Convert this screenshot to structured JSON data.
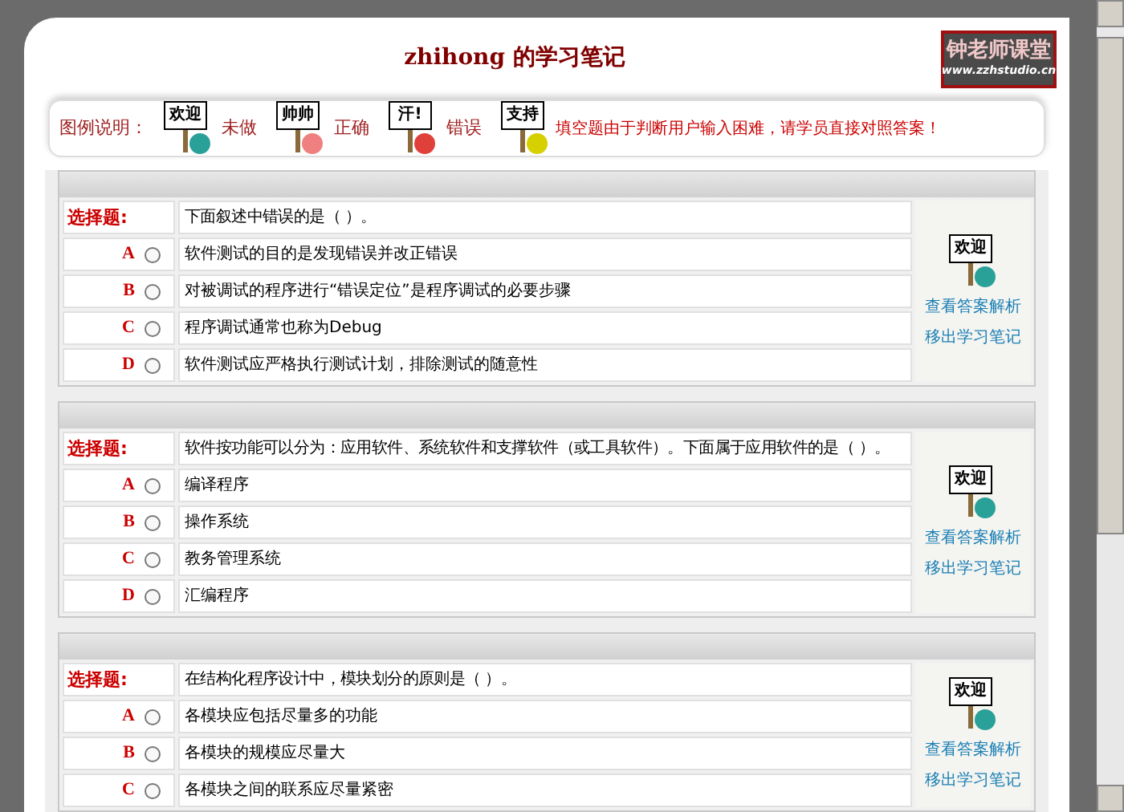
{
  "header": {
    "title": "zhihong 的学习笔记",
    "logo": {
      "name": "钟老师课堂",
      "url": "www.zzhstudio.cn"
    }
  },
  "legend": {
    "label": "图例说明：",
    "items": [
      {
        "sign": "欢迎",
        "label": "未做",
        "color": "#2aa198"
      },
      {
        "sign": "帅帅",
        "label": "正确",
        "color": "#f08080"
      },
      {
        "sign": "汗!",
        "label": "错误",
        "color": "#e0403a"
      },
      {
        "sign": "支持"
      }
    ],
    "note": "填空题由于判断用户输入困难，请学员直接对照答案！"
  },
  "questions": [
    {
      "type_label": "选择题:",
      "text": "下面叙述中错误的是（ ）。",
      "status_sign": "欢迎",
      "links": [
        "查看答案解析",
        "移出学习笔记"
      ],
      "options": [
        {
          "letter": "A",
          "text": "软件测试的目的是发现错误并改正错误",
          "selected": false
        },
        {
          "letter": "B",
          "text": "对被调试的程序进行“错误定位”是程序调试的必要步骤",
          "selected": false
        },
        {
          "letter": "C",
          "text": "程序调试通常也称为Debug",
          "selected": false
        },
        {
          "letter": "D",
          "text": "软件测试应严格执行测试计划，排除测试的随意性",
          "selected": false
        }
      ]
    },
    {
      "type_label": "选择题:",
      "text": "软件按功能可以分为：应用软件、系统软件和支撑软件（或工具软件）。下面属于应用软件的是（ ）。",
      "status_sign": "欢迎",
      "links": [
        "查看答案解析",
        "移出学习笔记"
      ],
      "options": [
        {
          "letter": "A",
          "text": "编译程序",
          "selected": false
        },
        {
          "letter": "B",
          "text": "操作系统",
          "selected": false
        },
        {
          "letter": "C",
          "text": "教务管理系统",
          "selected": false
        },
        {
          "letter": "D",
          "text": "汇编程序",
          "selected": false
        }
      ]
    },
    {
      "type_label": "选择题:",
      "text": "在结构化程序设计中，模块划分的原则是（ ）。",
      "status_sign": "欢迎",
      "links": [
        "查看答案解析",
        "移出学习笔记"
      ],
      "options": [
        {
          "letter": "A",
          "text": "各模块应包括尽量多的功能",
          "selected": false
        },
        {
          "letter": "B",
          "text": "各模块的规模应尽量大",
          "selected": false
        },
        {
          "letter": "C",
          "text": "各模块之间的联系应尽量紧密",
          "selected": false
        }
      ]
    }
  ]
}
